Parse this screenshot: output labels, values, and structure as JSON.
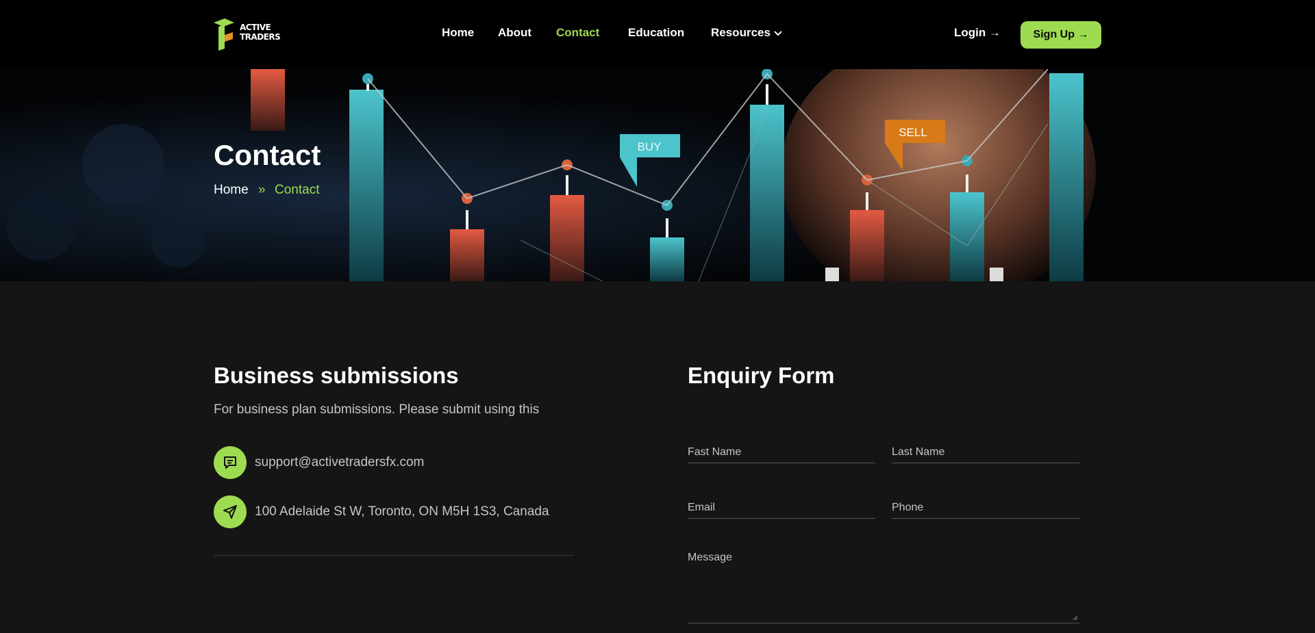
{
  "brand": {
    "line1": "ACTIVE",
    "line2": "TRADERS",
    "color": "#9ddb50"
  },
  "nav": {
    "home": "Home",
    "about": "About",
    "contact": "Contact",
    "education": "Education",
    "resources": "Resources"
  },
  "auth": {
    "login": "Login →",
    "signup": "Sign Up →"
  },
  "hero": {
    "title": "Contact",
    "breadcrumb": {
      "home": "Home",
      "separator": "»",
      "current": "Contact"
    },
    "buy_label": "BUY",
    "sell_label": "SELL"
  },
  "business": {
    "title": "Business submissions",
    "subtitle": "For business plan submissions. Please submit using this",
    "email": "support@activetradersfx.com",
    "address": "100 Adelaide St W, Toronto, ON M5H 1S3, Canada"
  },
  "form": {
    "title": "Enquiry Form",
    "first_name_placeholder": "Fast Name",
    "last_name_placeholder": "Last Name",
    "email_placeholder": "Email",
    "phone_placeholder": "Phone",
    "message_placeholder": "Message"
  },
  "colors": {
    "accent": "#9ddb50",
    "background": "#151515",
    "header": "#000000"
  }
}
